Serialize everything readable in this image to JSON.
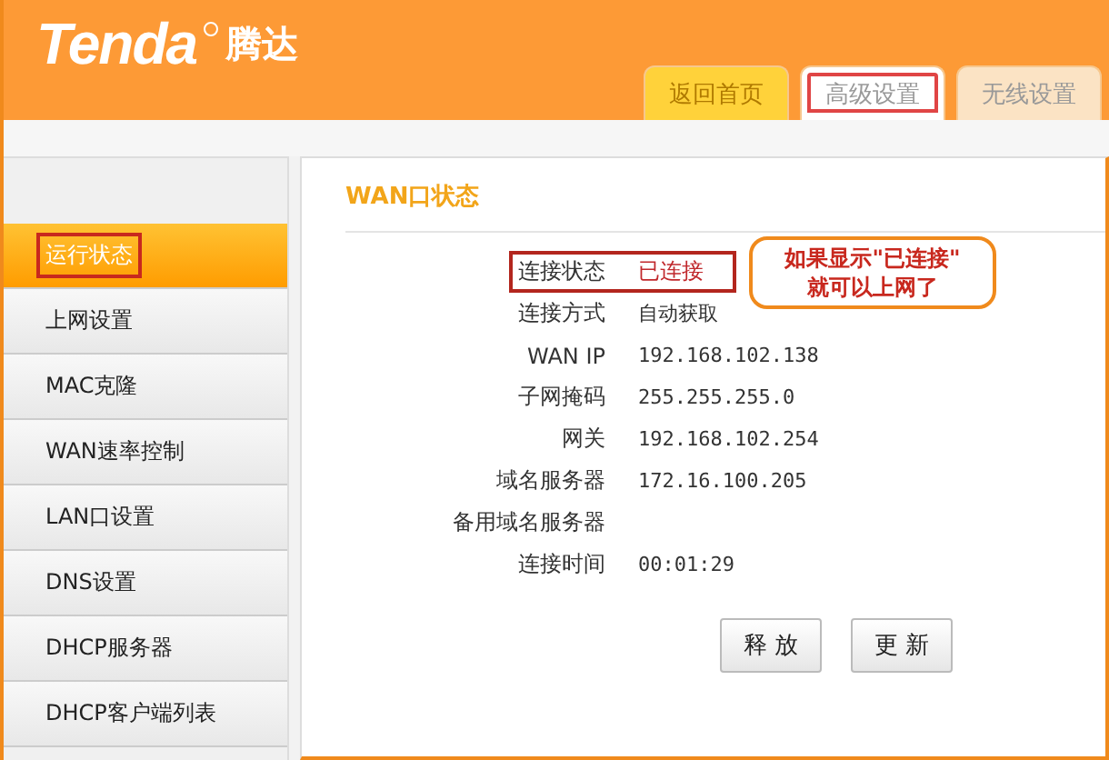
{
  "header": {
    "brand": "Tenda",
    "brand_cn": "腾达"
  },
  "tabs": [
    {
      "label": "返回首页",
      "selected": true,
      "highlighted": false
    },
    {
      "label": "高级设置",
      "selected": false,
      "highlighted": true
    },
    {
      "label": "无线设置",
      "selected": false,
      "highlighted": false
    }
  ],
  "sidebar": {
    "items": [
      {
        "label": "运行状态",
        "selected": true,
        "highlighted": true
      },
      {
        "label": "上网设置",
        "selected": false,
        "highlighted": false
      },
      {
        "label": "MAC克隆",
        "selected": false,
        "highlighted": false
      },
      {
        "label": "WAN速率控制",
        "selected": false,
        "highlighted": false
      },
      {
        "label": "LAN口设置",
        "selected": false,
        "highlighted": false
      },
      {
        "label": "DNS设置",
        "selected": false,
        "highlighted": false
      },
      {
        "label": "DHCP服务器",
        "selected": false,
        "highlighted": false
      },
      {
        "label": "DHCP客户端列表",
        "selected": false,
        "highlighted": false
      }
    ]
  },
  "panel": {
    "title": "WAN口状态",
    "rows": [
      {
        "label": "连接状态",
        "value": "已连接",
        "highlighted": true
      },
      {
        "label": "连接方式",
        "value": "自动获取",
        "highlighted": false
      },
      {
        "label": "WAN IP",
        "value": "192.168.102.138",
        "highlighted": false
      },
      {
        "label": "子网掩码",
        "value": "255.255.255.0",
        "highlighted": false
      },
      {
        "label": "网关",
        "value": "192.168.102.254",
        "highlighted": false
      },
      {
        "label": "域名服务器",
        "value": "172.16.100.205",
        "highlighted": false
      },
      {
        "label": "备用域名服务器",
        "highlighted": false
      },
      {
        "label": "连接时间",
        "value": "00:01:29",
        "highlighted": false
      }
    ],
    "callout": [
      "如果显示\"已连接\"",
      "就可以上网了"
    ],
    "buttons": [
      "释 放",
      "更 新"
    ]
  }
}
